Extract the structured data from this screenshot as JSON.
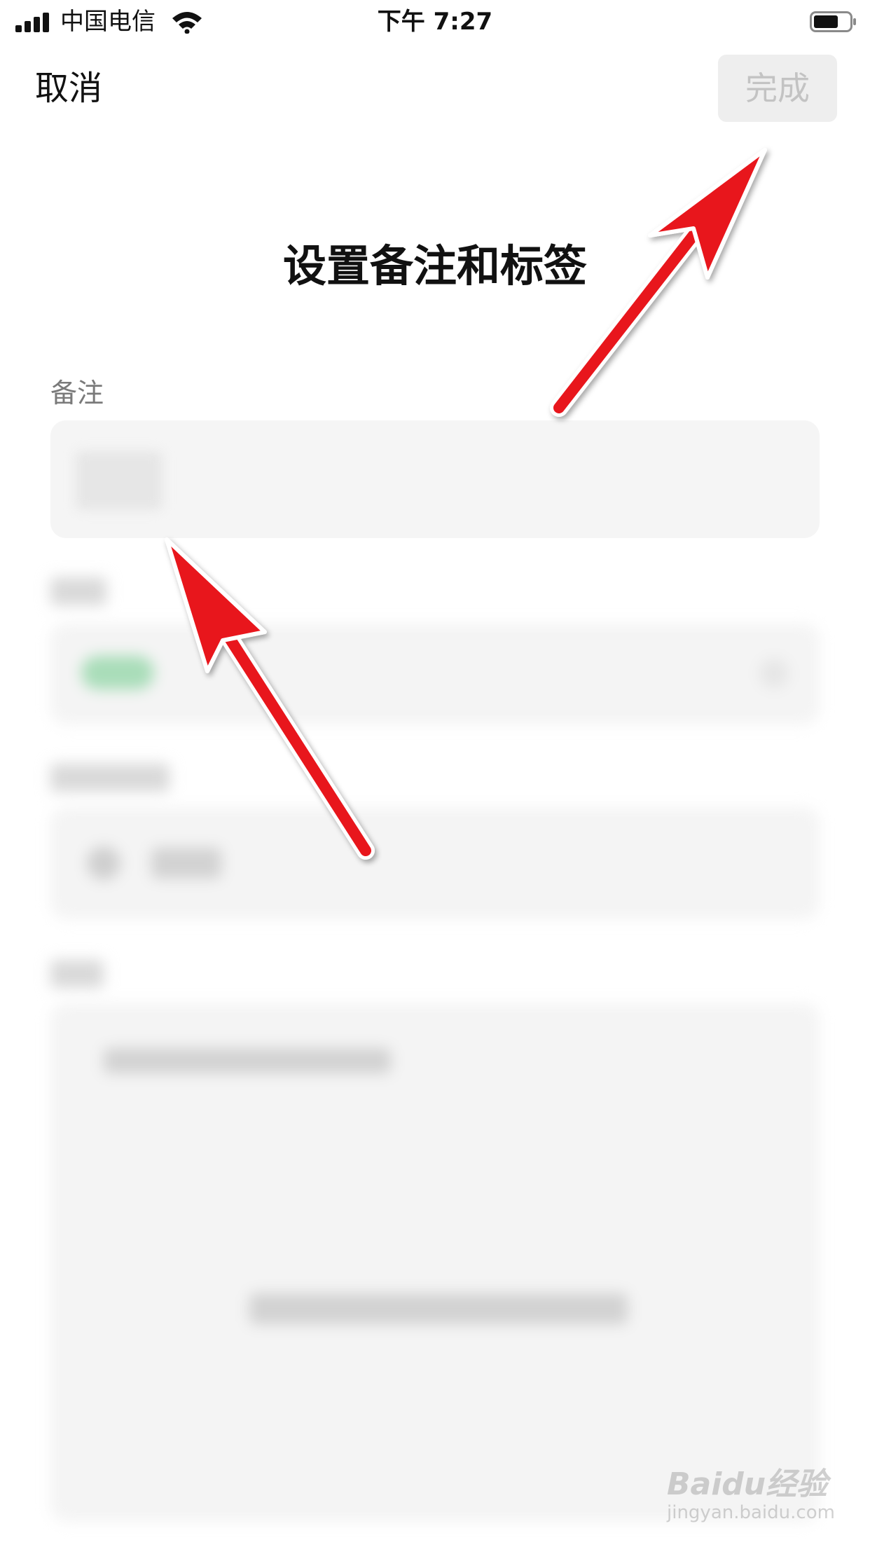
{
  "status_bar": {
    "carrier": "中国电信",
    "time": "下午 7:27"
  },
  "nav": {
    "cancel_label": "取消",
    "done_label": "完成"
  },
  "title": "设置备注和标签",
  "remark": {
    "label": "备注"
  },
  "watermark": {
    "main": "Baidu经验",
    "sub": "jingyan.baidu.com"
  },
  "colors": {
    "done_bg": "#eeeeee",
    "done_text": "#c3c3c3",
    "input_bg": "#f5f5f5",
    "arrow": "#e8141c"
  }
}
